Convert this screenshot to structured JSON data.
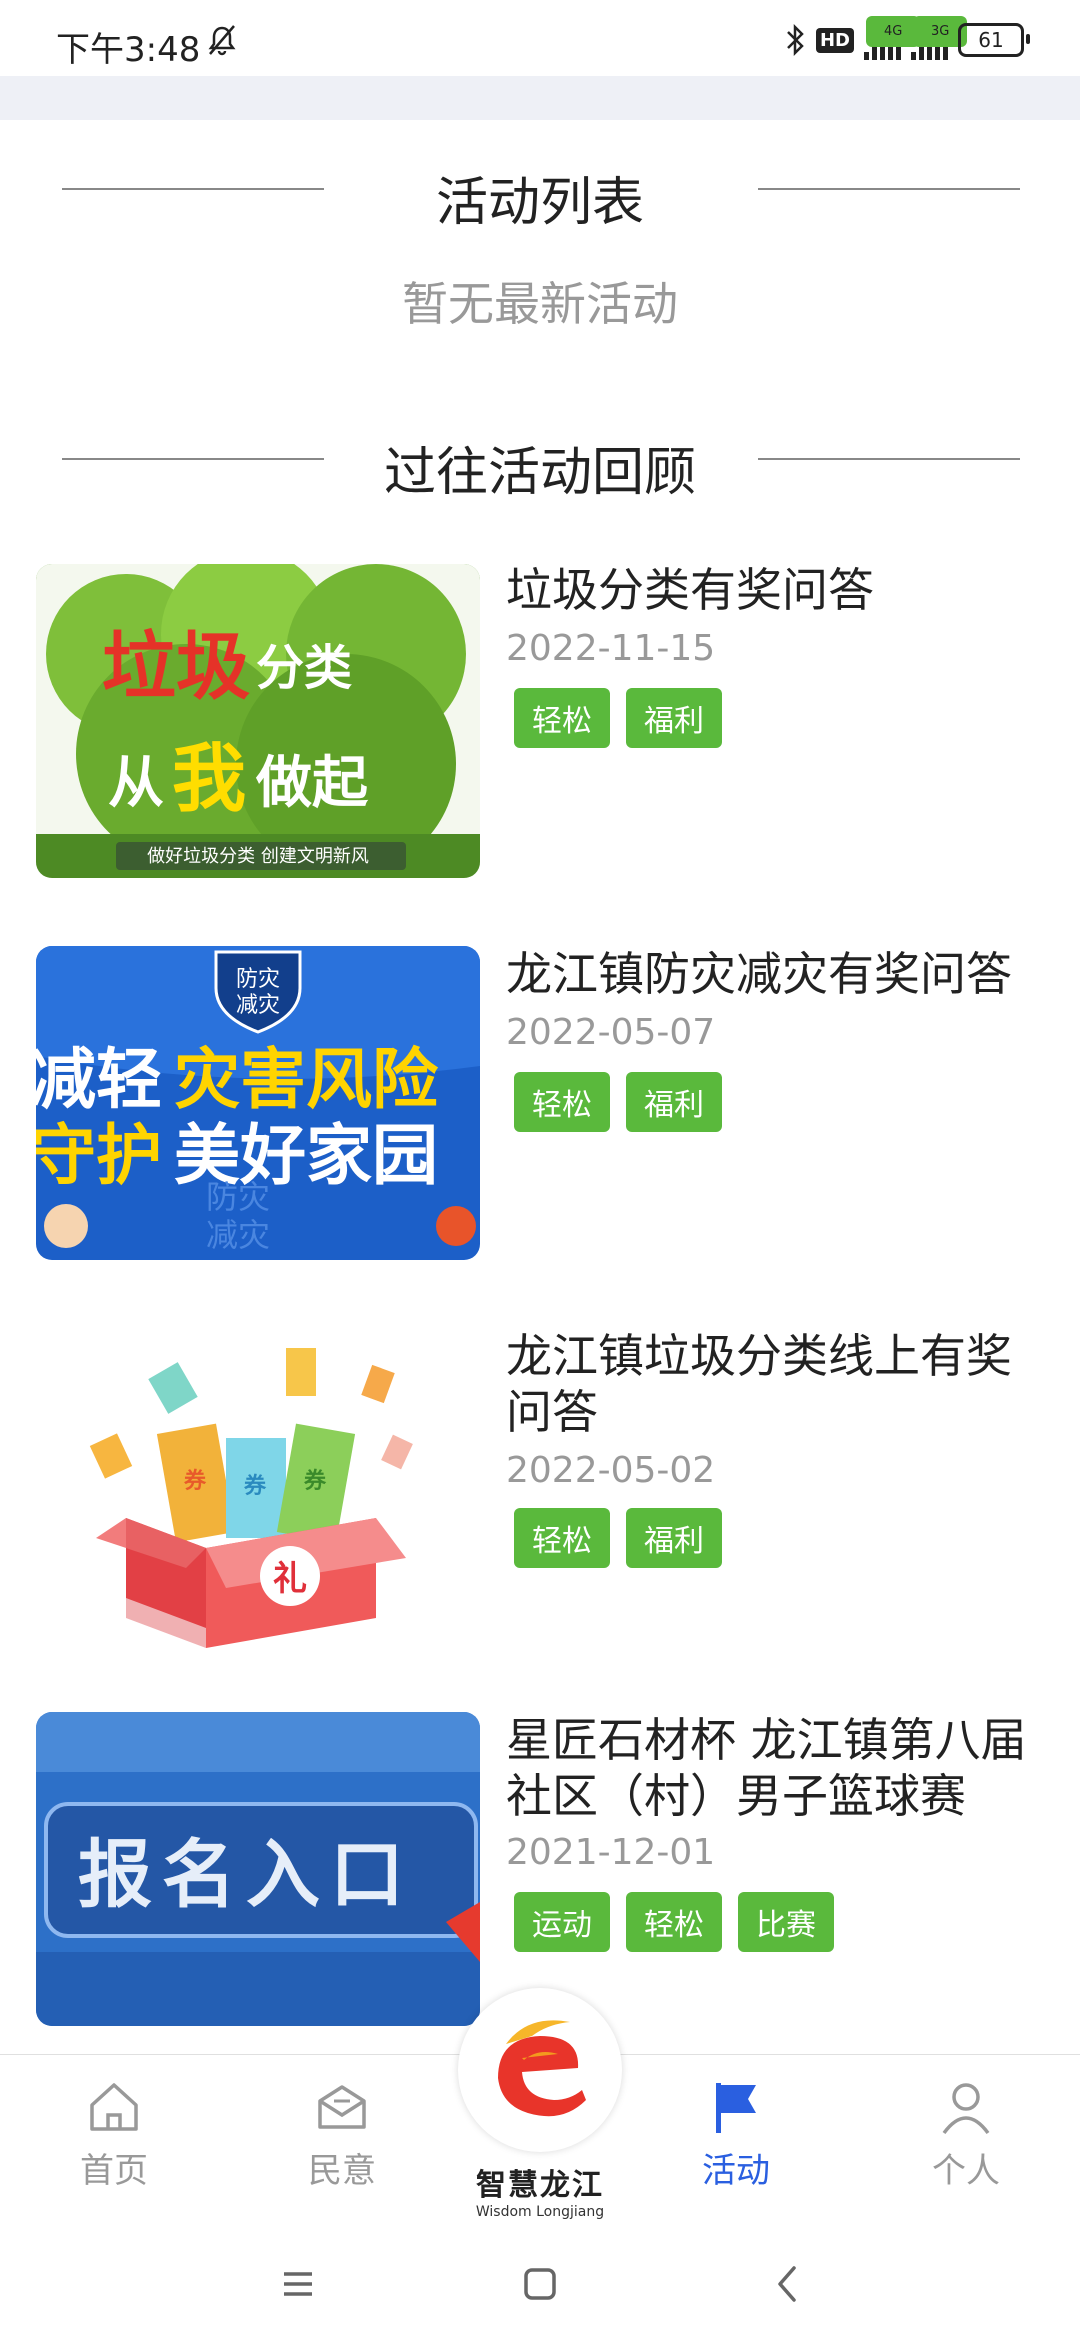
{
  "status_bar": {
    "time": "下午3:48",
    "hd": "HD",
    "net1": "4G",
    "net2": "3G",
    "battery": "61"
  },
  "section_current": {
    "title": "活动列表",
    "empty_text": "暂无最新活动"
  },
  "section_past": {
    "title": "过往活动回顾",
    "items": [
      {
        "title": "垃圾分类有奖问答",
        "date": "2022-11-15",
        "tags": [
          "轻松",
          "福利"
        ],
        "thumb_text": [
          "垃圾",
          "分类",
          "从",
          "我",
          "做起",
          "做好垃圾分类 创建文明新风"
        ]
      },
      {
        "title": "龙江镇防灾减灾有奖问答",
        "date": "2022-05-07",
        "tags": [
          "轻松",
          "福利"
        ],
        "thumb_text": [
          "防灾",
          "减灾",
          "减轻",
          "灾害风险",
          "守护",
          "美好家园",
          "防灾",
          "减灾"
        ]
      },
      {
        "title": "龙江镇垃圾分类线上有奖问答",
        "date": "2022-05-02",
        "tags": [
          "轻松",
          "福利"
        ],
        "thumb_text": [
          "券",
          "券",
          "券",
          "礼"
        ]
      },
      {
        "title": "星匠石材杯 龙江镇第八届社区（村）男子篮球赛",
        "date": "2021-12-01",
        "tags": [
          "运动",
          "轻松",
          "比赛"
        ],
        "thumb_text": [
          "报名入口"
        ]
      }
    ]
  },
  "tabbar": {
    "tabs": [
      {
        "label": "首页",
        "icon": "home-icon"
      },
      {
        "label": "民意",
        "icon": "mail-icon"
      },
      {
        "label": "活动",
        "icon": "flag-icon"
      },
      {
        "label": "个人",
        "icon": "person-icon"
      }
    ],
    "logo_cn": "智慧龙江",
    "logo_en": "Wisdom Longjiang",
    "active_color": "#2a5fe0"
  },
  "colors": {
    "tag_green": "#5ab93c",
    "page_gray": "#eef0f6"
  }
}
